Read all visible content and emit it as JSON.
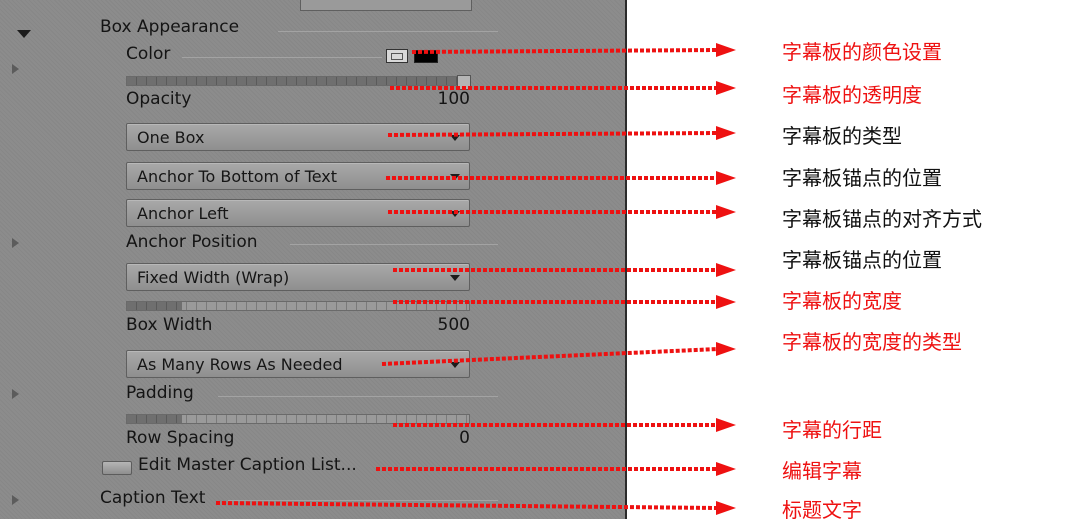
{
  "panel": {
    "section_title": "Box Appearance",
    "color_label": "Color",
    "opacity": {
      "label": "Opacity",
      "value": "100",
      "level": 1.0
    },
    "box_type": "One Box",
    "anchor_vertical": "Anchor To Bottom of Text",
    "anchor_horizontal": "Anchor Left",
    "anchor_position_label": "Anchor Position",
    "width_mode": "Fixed Width (Wrap)",
    "box_width": {
      "label": "Box Width",
      "value": "500"
    },
    "rows_mode": "As Many Rows As Needed",
    "padding_label": "Padding",
    "row_spacing": {
      "label": "Row Spacing",
      "value": "0"
    },
    "edit_button": "Edit Master Caption List...",
    "caption_text_label": "Caption Text"
  },
  "annotations": [
    {
      "text": "字幕板的颜色设置",
      "color": "#ee1111"
    },
    {
      "text": "字幕板的透明度",
      "color": "#ee1111"
    },
    {
      "text": "字幕板的类型",
      "color": "#111111"
    },
    {
      "text": "字幕板锚点的位置",
      "color": "#111111"
    },
    {
      "text": "字幕板锚点的对齐方式",
      "color": "#111111"
    },
    {
      "text": "字幕板锚点的位置",
      "color": "#111111"
    },
    {
      "text": "字幕板的宽度",
      "color": "#ee1111"
    },
    {
      "text": "字幕板的宽度的类型",
      "color": "#ee1111"
    },
    {
      "text": "字幕的行距",
      "color": "#ee1111"
    },
    {
      "text": "编辑字幕",
      "color": "#ee1111"
    },
    {
      "text": "标题文字",
      "color": "#ee1111"
    }
  ],
  "colors": {
    "arrow": "#ee1111",
    "panel_bg": "#8c8c8c"
  },
  "icons": [
    "expand-triangle-icon",
    "collapse-triangle-icon",
    "color-picker-icon",
    "color-swatch",
    "dropdown-caret-icon",
    "dotted-arrow-icon"
  ]
}
